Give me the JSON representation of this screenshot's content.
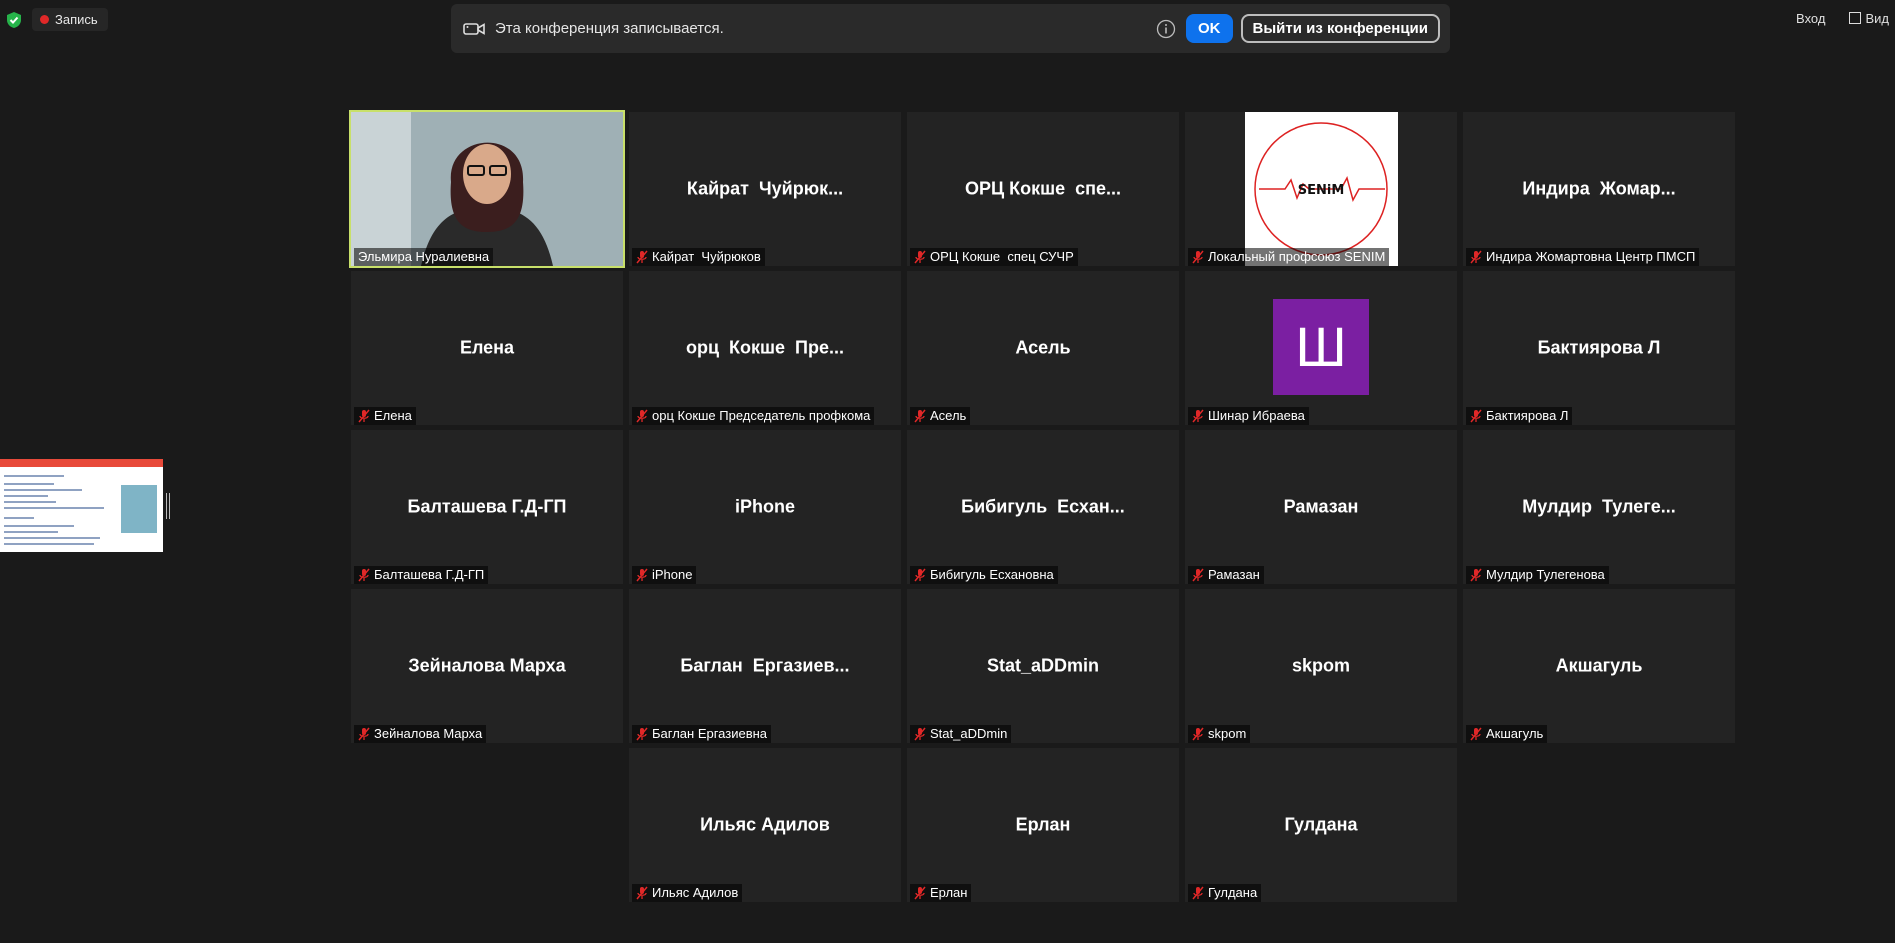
{
  "top_bar": {
    "recording_label": "Запись",
    "banner_message": "Эта конференция записывается.",
    "ok_label": "OK",
    "leave_label": "Выйти из конференции",
    "signin_label": "Вход",
    "view_label": "Вид"
  },
  "colors": {
    "accent_blue": "#0e72ed",
    "active_speaker_outline": "#c8e06a",
    "recording_red": "#e02828",
    "avatar_purple": "#7b1fa2"
  },
  "participants": [
    {
      "display": "",
      "label": "Эльмира Нуралиевна",
      "video": true,
      "muted": false,
      "active": true
    },
    {
      "display": "Кайрат  Чуйрюк...",
      "label": "Кайрат  Чуйрюков",
      "muted": true
    },
    {
      "display": "ОРЦ Кокше  спе...",
      "label": "ОРЦ Кокше  спец СУЧР",
      "muted": true
    },
    {
      "display": "",
      "label": "Локальный профсоюз SENIM",
      "avatar": "senim-logo",
      "avatar_text": "SENiM",
      "muted": true
    },
    {
      "display": "Индира  Жомар...",
      "label": "Индира Жомартовна Центр ПМСП",
      "muted": true
    },
    {
      "display": "Елена",
      "label": "Елена",
      "muted": true
    },
    {
      "display": "орц  Кокше  Пре...",
      "label": "орц Кокше Председатель профкома",
      "muted": true
    },
    {
      "display": "Асель",
      "label": "Асель",
      "muted": true
    },
    {
      "display": "",
      "label": "Шинар Ибраева",
      "avatar": "letter",
      "avatar_letter": "Ш",
      "muted": true
    },
    {
      "display": "Бактиярова Л",
      "label": "Бактиярова Л",
      "muted": true
    },
    {
      "display": "Балташева Г.Д-ГП",
      "label": "Балташева Г.Д-ГП",
      "muted": true
    },
    {
      "display": "iPhone",
      "label": "iPhone",
      "muted": true
    },
    {
      "display": "Бибигуль  Есхан...",
      "label": "Бибигуль Есхановна",
      "muted": true
    },
    {
      "display": "Рамазан",
      "label": "Рамазан",
      "muted": true
    },
    {
      "display": "Мулдир  Тулеге...",
      "label": "Мулдир Тулегенова",
      "muted": true
    },
    {
      "display": "Зейналова Марха",
      "label": "Зейналова Марха",
      "muted": true
    },
    {
      "display": "Баглан  Ергазиев...",
      "label": "Баглан Ергазиевна",
      "muted": true
    },
    {
      "display": "Stat_aDDmin",
      "label": "Stat_aDDmin",
      "muted": true
    },
    {
      "display": "skpom",
      "label": "skpom",
      "muted": true
    },
    {
      "display": "Акшагуль",
      "label": "Акшагуль",
      "muted": true
    },
    {
      "display": "Ильяс Адилов",
      "label": "Ильяс Адилов",
      "muted": true
    },
    {
      "display": "Ерлан",
      "label": "Ерлан",
      "muted": true
    },
    {
      "display": "Гулдана",
      "label": "Гулдана",
      "muted": true
    }
  ]
}
